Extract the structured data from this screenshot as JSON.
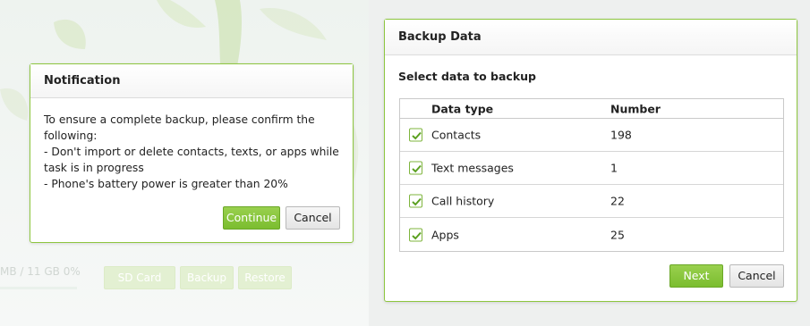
{
  "background": {
    "storage_text": "MB / 11 GB  0%",
    "buttons": [
      "SD Card",
      "Backup",
      "Restore"
    ]
  },
  "notification": {
    "title": "Notification",
    "message_lines": [
      "To ensure a complete backup, please confirm the",
      "following:",
      "- Don't import or delete contacts, texts, or apps while",
      "task is in progress",
      "- Phone's battery power is greater than 20%"
    ],
    "continue_label": "Continue",
    "cancel_label": "Cancel"
  },
  "backup": {
    "title": "Backup Data",
    "section_title": "Select data to backup",
    "columns": {
      "type": "Data type",
      "number": "Number"
    },
    "rows": [
      {
        "type": "Contacts",
        "number": "198",
        "checked": true
      },
      {
        "type": "Text messages",
        "number": "1",
        "checked": true
      },
      {
        "type": "Call history",
        "number": "22",
        "checked": true
      },
      {
        "type": "Apps",
        "number": "25",
        "checked": true
      }
    ],
    "next_label": "Next",
    "cancel_label": "Cancel"
  },
  "colors": {
    "accent": "#8dc63f",
    "primary_button": "#7bbd2f"
  },
  "icons": {
    "checkbox": "checkmark-icon"
  }
}
